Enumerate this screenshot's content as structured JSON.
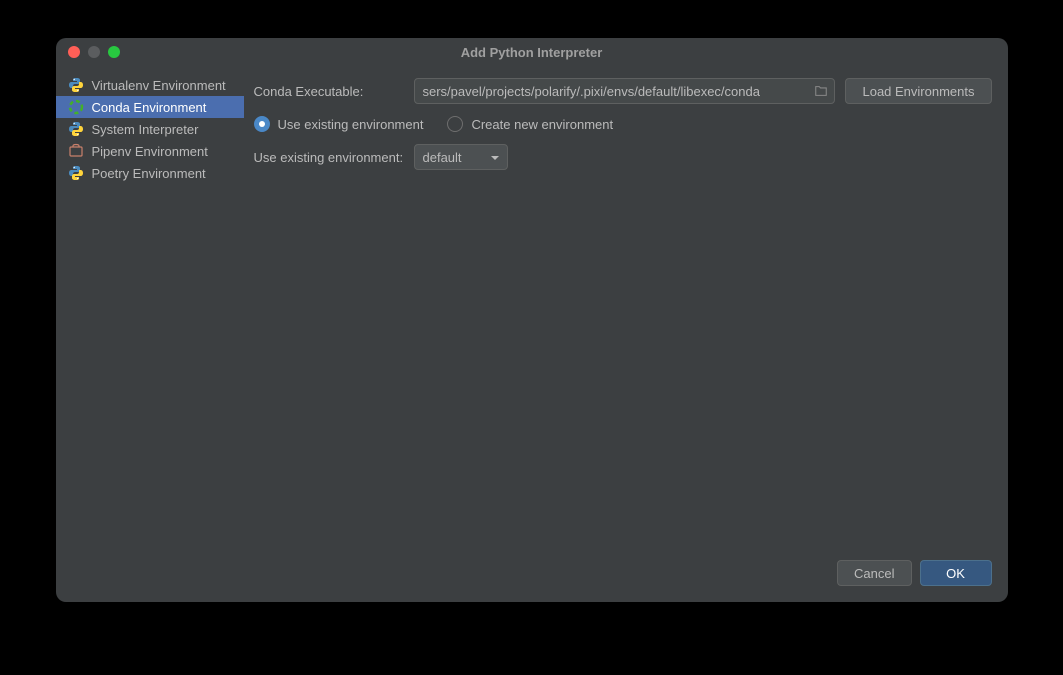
{
  "window": {
    "title": "Add Python Interpreter"
  },
  "sidebar": {
    "items": [
      {
        "label": "Virtualenv Environment",
        "selected": false
      },
      {
        "label": "Conda Environment",
        "selected": true
      },
      {
        "label": "System Interpreter",
        "selected": false
      },
      {
        "label": "Pipenv Environment",
        "selected": false
      },
      {
        "label": "Poetry Environment",
        "selected": false
      }
    ]
  },
  "form": {
    "conda_executable_label": "Conda Executable:",
    "conda_executable_value": "sers/pavel/projects/polarify/.pixi/envs/default/libexec/conda",
    "load_environments_label": "Load Environments",
    "radio_use_existing": "Use existing environment",
    "radio_create_new": "Create new environment",
    "use_existing_label": "Use existing environment:",
    "selected_environment": "default"
  },
  "footer": {
    "cancel_label": "Cancel",
    "ok_label": "OK"
  }
}
